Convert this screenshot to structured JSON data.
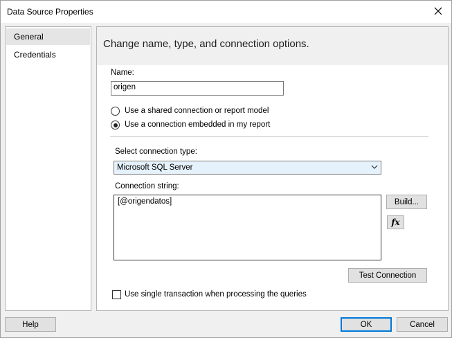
{
  "window": {
    "title": "Data Source Properties",
    "close_icon": "close-icon"
  },
  "nav": {
    "items": [
      {
        "label": "General",
        "selected": true
      },
      {
        "label": "Credentials",
        "selected": false
      }
    ]
  },
  "panel": {
    "title": "Change name, type, and connection options.",
    "name_label": "Name:",
    "name_value": "origen",
    "radio_shared_label": "Use a shared connection or report model",
    "radio_embedded_label": "Use a connection embedded in my report",
    "selected_radio": "embedded",
    "connection_type_label": "Select connection type:",
    "connection_type_value": "Microsoft SQL Server",
    "connection_string_label": "Connection string:",
    "connection_string_value": "[@origendatos]",
    "build_button": "Build...",
    "fx_button": "fx",
    "test_connection_button": "Test Connection",
    "single_transaction_label": "Use single transaction when processing the queries",
    "single_transaction_checked": false
  },
  "footer": {
    "help_button": "Help",
    "ok_button": "OK",
    "cancel_button": "Cancel"
  },
  "colors": {
    "accent": "#0078d7",
    "select_bg": "#e5f1fb"
  }
}
